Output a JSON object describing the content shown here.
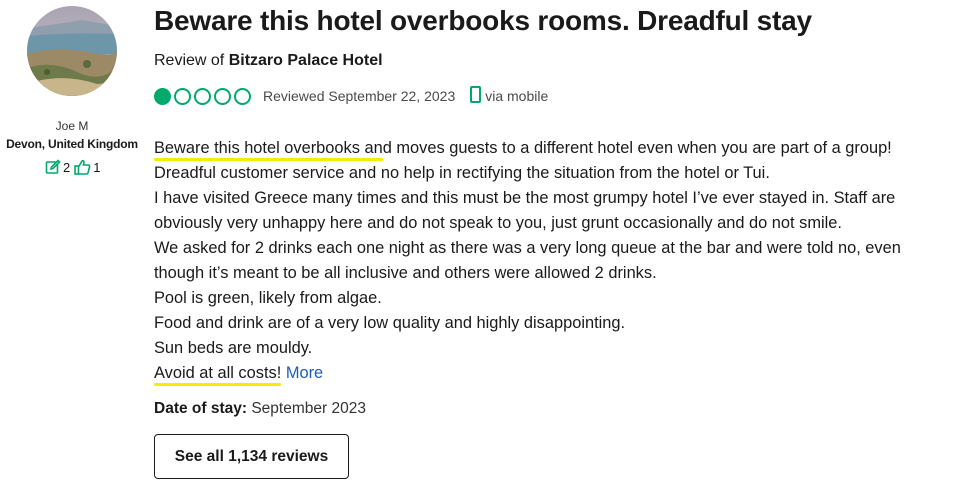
{
  "reviewer": {
    "name": "Joe M",
    "location": "Devon, United Kingdom",
    "contributions": "2",
    "helpful_votes": "1",
    "avatar_icon": "landscape-photo"
  },
  "review": {
    "title": "Beware this hotel overbooks rooms. Dreadful stay",
    "subtitle_prefix": "Review of ",
    "hotel_name": "Bitzaro Palace Hotel",
    "rating": 1,
    "rating_max": 5,
    "reviewed_date": "Reviewed September 22, 2023",
    "via": "via mobile",
    "lines": {
      "l1_highlight": "Beware this hotel overbooks an",
      "l1_rest": "d moves guests to a different hotel even when you are part of a group!",
      "l2": "Dreadful customer service and no help in rectifying the situation from the hotel or Tui.",
      "l3": "I have visited Greece many times and this must be the most grumpy hotel I’ve ever stayed in. Staff are",
      "l4": "obviously very unhappy here and do not speak to you, just grunt occasionally and do not smile.",
      "l5": "We asked for 2 drinks each one night as there was a very long queue at the bar and were told no, even",
      "l6": "though it’s meant to be all inclusive and others were allowed 2 drinks.",
      "l7": "Pool is green, likely from algae.",
      "l8": "Food and drink are of a very low quality and highly disappointing.",
      "l9": "Sun beds are mouldy.",
      "l10_highlight": "Avoid at all costs!"
    },
    "more_label": "More",
    "date_of_stay_label": "Date of stay:",
    "date_of_stay_value": "September 2023"
  },
  "buttons": {
    "see_all": "See all 1,134 reviews"
  },
  "colors": {
    "rating_green": "#00aa6c",
    "highlight_yellow": "#f5ec00",
    "link_blue": "#1a5dbb"
  }
}
